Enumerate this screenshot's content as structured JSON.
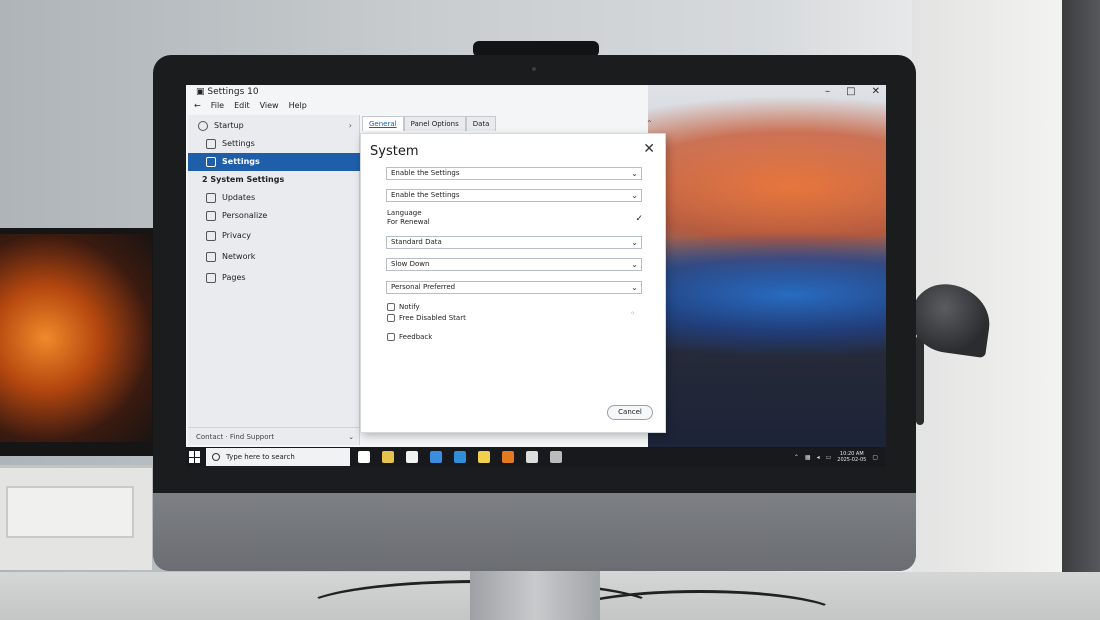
{
  "window": {
    "title": "Settings 10",
    "controls": [
      "–",
      "□",
      "✕"
    ]
  },
  "menubar": [
    "File",
    "Edit",
    "View",
    "Help"
  ],
  "sidebar": {
    "items": [
      {
        "label": "Startup",
        "icon": "clock-icon"
      },
      {
        "label": "Settings",
        "icon": "settings-icon"
      },
      {
        "label": "Settings",
        "icon": "settings-icon",
        "active": true
      },
      {
        "label": "2 System Settings",
        "icon": "",
        "header": true
      },
      {
        "label": "Updates",
        "icon": "update-icon"
      },
      {
        "label": "Personalize",
        "icon": "pen-icon"
      },
      {
        "label": "Privacy",
        "icon": "document-icon"
      },
      {
        "label": "Network",
        "icon": "network-icon"
      },
      {
        "label": "Pages",
        "icon": "pages-icon"
      }
    ],
    "footer": "Contact · Find Support"
  },
  "tabs": [
    {
      "label": "General",
      "selected": true
    },
    {
      "label": "Panel Options",
      "selected": false
    },
    {
      "label": "Data",
      "selected": false
    }
  ],
  "dialog": {
    "title": "System",
    "selects": [
      "Enable the Settings",
      "Enable the Settings",
      "Standard Data",
      "Slow Down",
      "Personal Preferred"
    ],
    "label_lines": [
      "Language",
      "For Renewal"
    ],
    "checkboxes": [
      "Notify",
      "Free Disabled Start",
      "Feedback"
    ],
    "button": "Cancel"
  },
  "taskbar": {
    "search_text": "Type here to search",
    "clock_time": "10:20 AM",
    "clock_date": "2025-02-05",
    "apps": [
      {
        "name": "task-view-icon",
        "color": "#ffffff"
      },
      {
        "name": "folder-icon",
        "color": "#e6c34a"
      },
      {
        "name": "notepad-icon",
        "color": "#f2f2f2"
      },
      {
        "name": "browser-icon",
        "color": "#3b8de0"
      },
      {
        "name": "store-icon",
        "color": "#2f8fd8"
      },
      {
        "name": "mail-icon",
        "color": "#f0d04c"
      },
      {
        "name": "office-icon",
        "color": "#e37a1f"
      },
      {
        "name": "settings-app-icon",
        "color": "#dddddd"
      },
      {
        "name": "tools-icon",
        "color": "#bbbbbb"
      }
    ]
  },
  "colors": {
    "accent": "#1f5ea9",
    "taskbar": "#17191c"
  }
}
